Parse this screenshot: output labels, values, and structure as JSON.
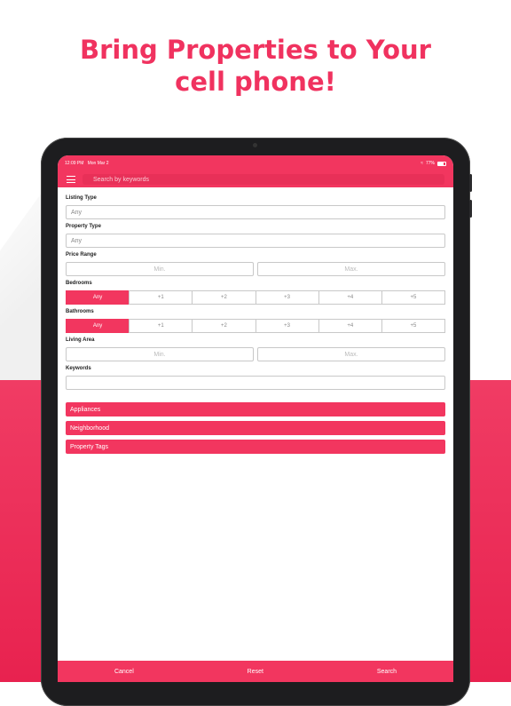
{
  "headline": {
    "line1": "Bring Properties to Your",
    "line2": "cell phone!"
  },
  "statusbar": {
    "time": "12:09 PM",
    "date": "Mon Mar 2",
    "battery": "77%"
  },
  "navbar": {
    "search_placeholder": "Search by keywords"
  },
  "form": {
    "listing_type": {
      "label": "Listing Type",
      "value": "Any"
    },
    "property_type": {
      "label": "Property Type",
      "value": "Any"
    },
    "price_range": {
      "label": "Price Range",
      "min": "Min.",
      "max": "Max."
    },
    "bedrooms": {
      "label": "Bedrooms",
      "options": [
        "Any",
        "+1",
        "+2",
        "+3",
        "+4",
        "+5"
      ]
    },
    "bathrooms": {
      "label": "Bathrooms",
      "options": [
        "Any",
        "+1",
        "+2",
        "+3",
        "+4",
        "+5"
      ]
    },
    "living_area": {
      "label": "Living Area",
      "min": "Min.",
      "max": "Max."
    },
    "keywords": {
      "label": "Keywords",
      "value": ""
    }
  },
  "sections": [
    "Appliances",
    "Neighborhood",
    "Property Tags"
  ],
  "bottombar": {
    "cancel": "Cancel",
    "reset": "Reset",
    "search": "Search"
  },
  "colors": {
    "accent": "#f2365f",
    "headline": "#f0325f"
  }
}
